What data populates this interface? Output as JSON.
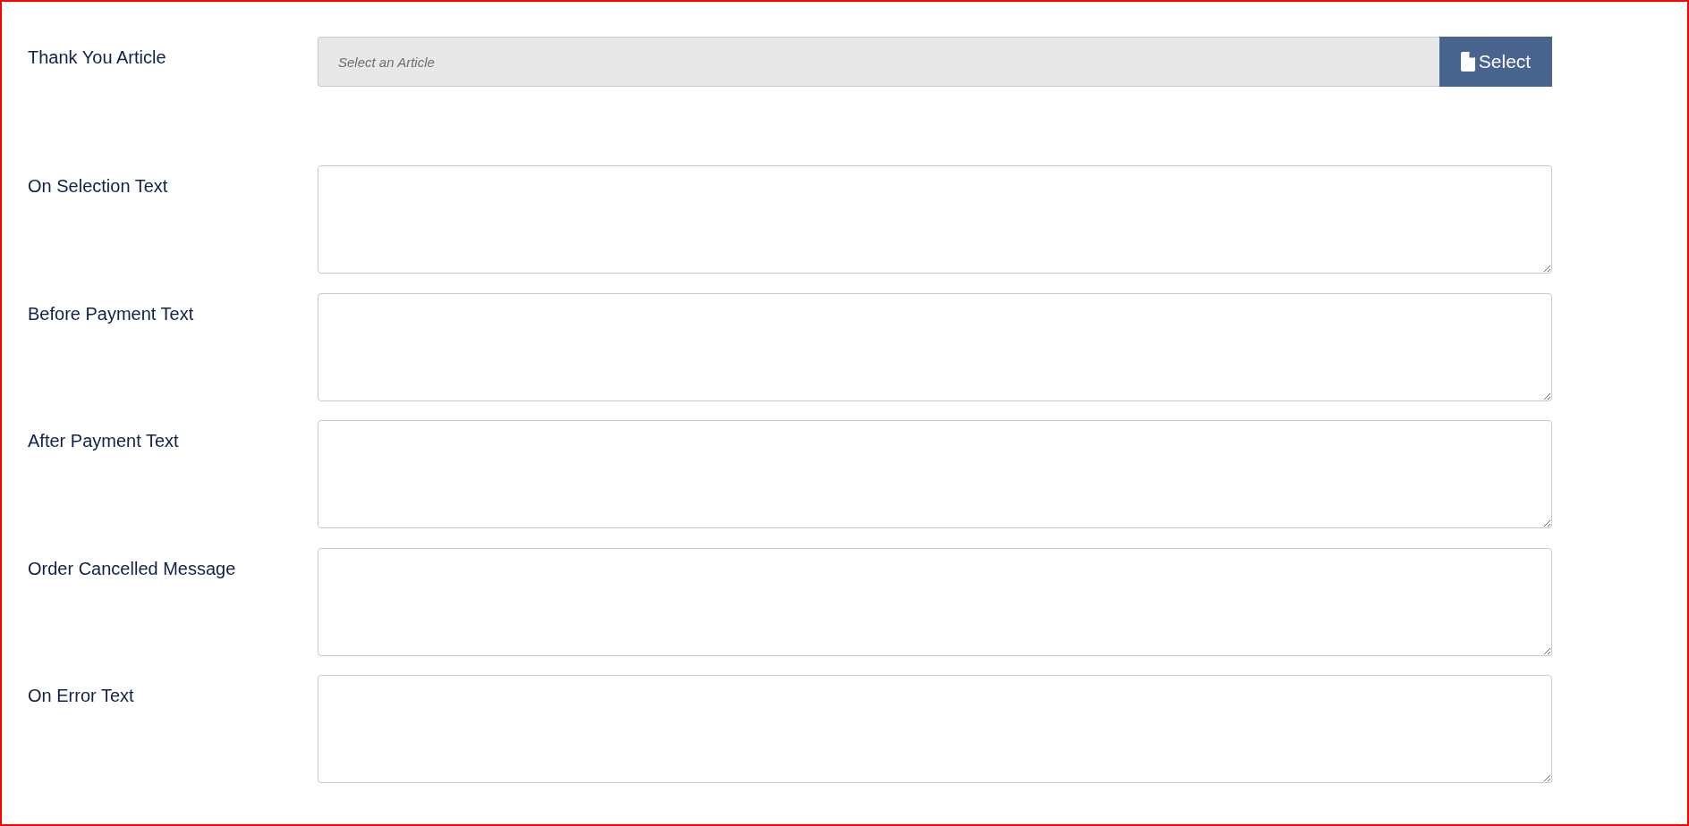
{
  "fields": [
    {
      "kind": "article-picker",
      "label": "Thank You Article",
      "placeholder": "Select an Article",
      "button": "Select"
    },
    {
      "kind": "textarea",
      "label": "On Selection Text"
    },
    {
      "kind": "textarea",
      "label": "Before Payment Text"
    },
    {
      "kind": "textarea",
      "label": "After Payment Text"
    },
    {
      "kind": "textarea",
      "label": "Order Cancelled Message"
    },
    {
      "kind": "textarea",
      "label": "On Error Text"
    }
  ]
}
